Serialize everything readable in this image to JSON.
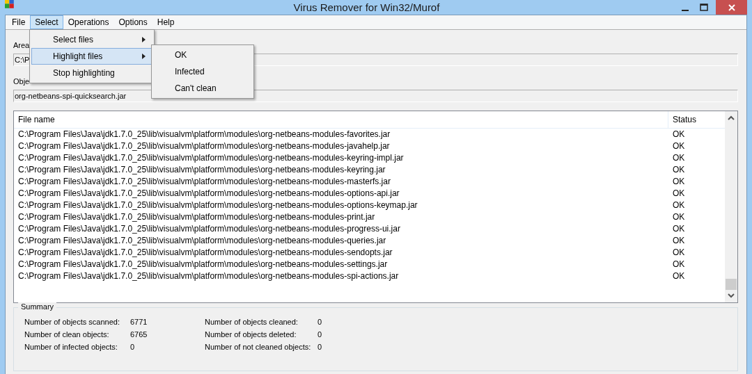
{
  "window": {
    "title": "Virus Remover for Win32/Murof"
  },
  "menu_bar": [
    {
      "label": "File",
      "selected": false
    },
    {
      "label": "Select",
      "selected": true
    },
    {
      "label": "Operations",
      "selected": false
    },
    {
      "label": "Options",
      "selected": false
    },
    {
      "label": "Help",
      "selected": false
    }
  ],
  "dropdown": {
    "items": [
      {
        "label": "Select files",
        "selected": false,
        "submenu": true
      },
      {
        "label": "Highlight files",
        "selected": true,
        "submenu": true
      },
      {
        "label": "Stop highlighting",
        "selected": false,
        "submenu": false
      }
    ]
  },
  "submenu": {
    "items": [
      {
        "label": "OK"
      },
      {
        "label": "Infected"
      },
      {
        "label": "Can't clean"
      }
    ]
  },
  "area": {
    "label": "Area",
    "value": "C:\\P"
  },
  "object": {
    "label": "Obje",
    "value": "org-netbeans-spi-quicksearch.jar"
  },
  "table": {
    "columns": [
      "File name",
      "Status"
    ],
    "rows": [
      [
        "C:\\Program Files\\Java\\jdk1.7.0_25\\lib\\visualvm\\platform\\modules\\org-netbeans-modules-favorites.jar",
        "OK"
      ],
      [
        "C:\\Program Files\\Java\\jdk1.7.0_25\\lib\\visualvm\\platform\\modules\\org-netbeans-modules-javahelp.jar",
        "OK"
      ],
      [
        "C:\\Program Files\\Java\\jdk1.7.0_25\\lib\\visualvm\\platform\\modules\\org-netbeans-modules-keyring-impl.jar",
        "OK"
      ],
      [
        "C:\\Program Files\\Java\\jdk1.7.0_25\\lib\\visualvm\\platform\\modules\\org-netbeans-modules-keyring.jar",
        "OK"
      ],
      [
        "C:\\Program Files\\Java\\jdk1.7.0_25\\lib\\visualvm\\platform\\modules\\org-netbeans-modules-masterfs.jar",
        "OK"
      ],
      [
        "C:\\Program Files\\Java\\jdk1.7.0_25\\lib\\visualvm\\platform\\modules\\org-netbeans-modules-options-api.jar",
        "OK"
      ],
      [
        "C:\\Program Files\\Java\\jdk1.7.0_25\\lib\\visualvm\\platform\\modules\\org-netbeans-modules-options-keymap.jar",
        "OK"
      ],
      [
        "C:\\Program Files\\Java\\jdk1.7.0_25\\lib\\visualvm\\platform\\modules\\org-netbeans-modules-print.jar",
        "OK"
      ],
      [
        "C:\\Program Files\\Java\\jdk1.7.0_25\\lib\\visualvm\\platform\\modules\\org-netbeans-modules-progress-ui.jar",
        "OK"
      ],
      [
        "C:\\Program Files\\Java\\jdk1.7.0_25\\lib\\visualvm\\platform\\modules\\org-netbeans-modules-queries.jar",
        "OK"
      ],
      [
        "C:\\Program Files\\Java\\jdk1.7.0_25\\lib\\visualvm\\platform\\modules\\org-netbeans-modules-sendopts.jar",
        "OK"
      ],
      [
        "C:\\Program Files\\Java\\jdk1.7.0_25\\lib\\visualvm\\platform\\modules\\org-netbeans-modules-settings.jar",
        "OK"
      ],
      [
        "C:\\Program Files\\Java\\jdk1.7.0_25\\lib\\visualvm\\platform\\modules\\org-netbeans-modules-spi-actions.jar",
        "OK"
      ]
    ]
  },
  "summary": {
    "title": "Summary",
    "stats": [
      {
        "label": "Number of objects scanned:",
        "value": "6771"
      },
      {
        "label": "Number of objects cleaned:",
        "value": "0"
      },
      {
        "label": "Number of clean objects:",
        "value": "6765"
      },
      {
        "label": "Number of objects deleted:",
        "value": "0"
      },
      {
        "label": "Number of infected objects:",
        "value": "0"
      },
      {
        "label": "Number of not cleaned objects:",
        "value": "0"
      }
    ]
  }
}
